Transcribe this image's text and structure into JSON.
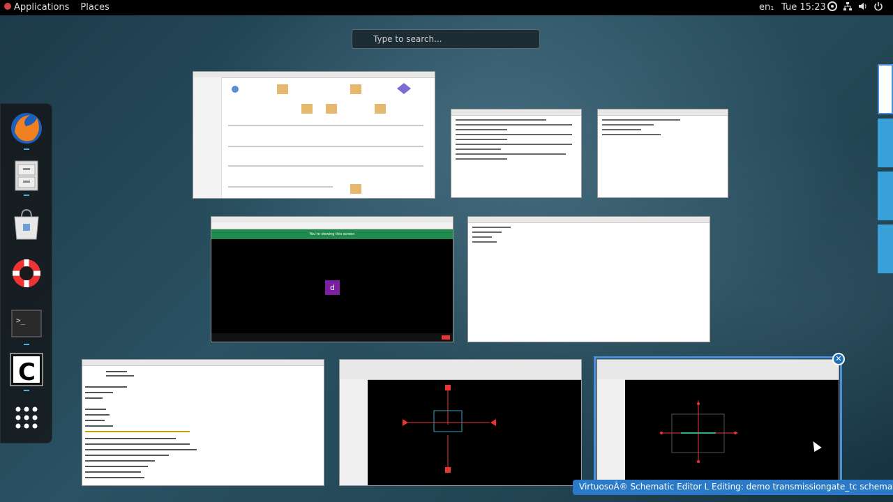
{
  "topbar": {
    "applications": "Applications",
    "places": "Places",
    "keyboard": "en₁",
    "clock": "Tue 15:23"
  },
  "search": {
    "placeholder": "Type to search..."
  },
  "dash": {
    "items": [
      "firefox-icon",
      "file-cabinet-icon",
      "software-bag-icon",
      "help-lifebuoy-icon",
      "terminal-icon",
      "cadence-icon",
      "show-apps-icon"
    ]
  },
  "windows": {
    "meeting": {
      "avatar_letter": "d",
      "banner": "You're viewing this screen"
    }
  },
  "tooltip": {
    "text": "VirtuosoÂ® Schematic Editor L Editing: demo transmissiongate_tc schematic *"
  },
  "colors": {
    "accent": "#4a90d9",
    "tooltip_bg": "#2a7ac8",
    "meeting_green": "#1f8a4c",
    "avatar_purple": "#7b1fa2"
  }
}
